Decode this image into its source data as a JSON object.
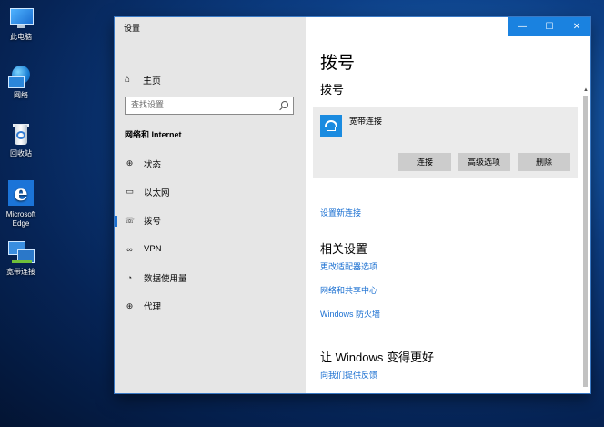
{
  "desktop": {
    "icons": [
      {
        "label": "此电脑",
        "icon": "computer-icon"
      },
      {
        "label": "网络",
        "icon": "network-icon"
      },
      {
        "label": "回收站",
        "icon": "recycle-bin-icon"
      },
      {
        "label": "Microsoft Edge",
        "icon": "edge-icon"
      },
      {
        "label": "宽带连接",
        "icon": "broadband-connection-icon"
      }
    ]
  },
  "window": {
    "title": "设置",
    "controls": {
      "minimize": "—",
      "maximize": "☐",
      "close": "✕"
    }
  },
  "sidebar": {
    "home_label": "主页",
    "search_placeholder": "查找设置",
    "section_title": "网络和 Internet",
    "items": [
      {
        "label": "状态",
        "icon": "status-icon"
      },
      {
        "label": "以太网",
        "icon": "ethernet-icon"
      },
      {
        "label": "拨号",
        "icon": "dialup-icon",
        "active": true
      },
      {
        "label": "VPN",
        "icon": "vpn-icon"
      },
      {
        "label": "数据使用量",
        "icon": "data-usage-icon"
      },
      {
        "label": "代理",
        "icon": "proxy-icon"
      }
    ]
  },
  "content": {
    "page_title": "拨号",
    "section_title": "拨号",
    "connection": {
      "name": "宽带连接",
      "buttons": {
        "connect": "连接",
        "advanced": "高级选项",
        "delete": "删除"
      }
    },
    "setup_link": "设置新连接",
    "related": {
      "title": "相关设置",
      "links": [
        "更改适配器选项",
        "网络和共享中心",
        "Windows 防火墙"
      ]
    },
    "feedback": {
      "title": "让 Windows 变得更好",
      "link": "向我们提供反馈"
    }
  },
  "colors": {
    "accent": "#1a82e0",
    "link": "#1a6fd1",
    "sidebar_bg": "#e6e6e6"
  }
}
